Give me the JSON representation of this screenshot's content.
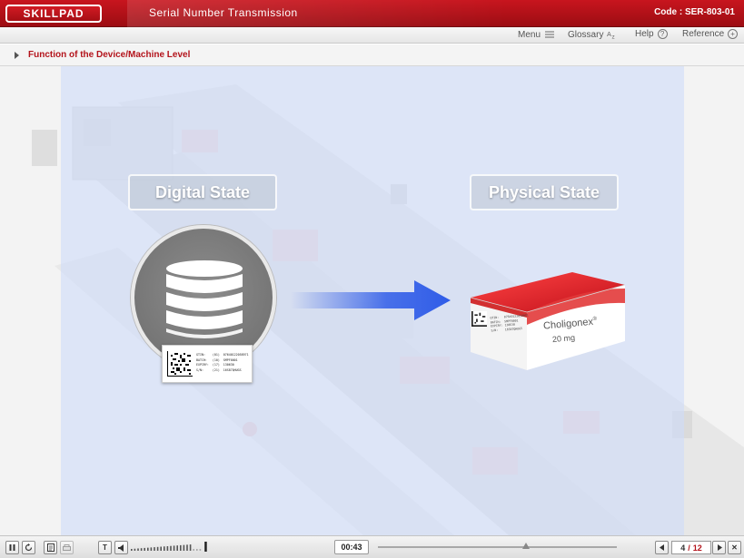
{
  "app": {
    "logo_text": "SKILLPAD",
    "title": "Serial Number Transmission",
    "code": "Code : SER-803-01"
  },
  "toolbar": {
    "menu": "Menu",
    "glossary": "Glossary",
    "help": "Help",
    "reference": "Reference"
  },
  "breadcrumb": {
    "text": "Function of the Device/Machine Level"
  },
  "stage": {
    "digital_label": "Digital State",
    "physical_label": "Physical State",
    "label_lines": "GTIN:    (01)  07640122058971\nBATCH:   (10)  SMPF0001\nEXPIRY:  (17)  130630\nS/N:     (21)  16S87QHUGS",
    "box_lines": "GTIN:   07640122058971\nBATCH:  SMPF0001\nEXPIRY: 130630\nS/N:    16S87QHUGS",
    "product_name": "Choligonex",
    "product_mark": "®",
    "product_dose": "20 mg"
  },
  "player": {
    "time": "00:43",
    "current_page": "4",
    "page_sep": "/",
    "total_pages": "12",
    "progress_fraction": 0.62,
    "volume_fraction": 0.9
  },
  "colors": {
    "brand_red": "#b3131b",
    "panel_blue": "#cedcf8",
    "arrow_blue": "#2f5ce8"
  }
}
